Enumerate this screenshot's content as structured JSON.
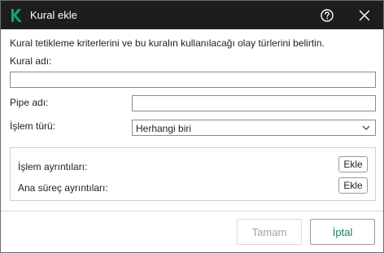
{
  "window": {
    "title": "Kural ekle",
    "icons": {
      "logo": "kaspersky-k-logo",
      "help": "question-circle-icon",
      "close": "close-x-icon"
    },
    "colors": {
      "titlebar": "#1d1d1d",
      "brand": "#00a88e",
      "cancel_text": "#1a7f60",
      "disabled_text": "#a3a3a3"
    }
  },
  "form": {
    "description": "Kural tetikleme kriterlerini ve bu kuralın kullanılacağı olay türlerini belirtin.",
    "rule_name": {
      "label": "Kural adı:",
      "value": ""
    },
    "pipe_name": {
      "label": "Pipe adı:",
      "value": ""
    },
    "operation_type": {
      "label": "İşlem türü:",
      "selected": "Herhangi biri"
    }
  },
  "details": {
    "operation_details_label": "İşlem ayrıntıları:",
    "operation_add_label": "Ekle",
    "parent_details_label": "Ana süreç ayrıntıları:",
    "parent_add_label": "Ekle"
  },
  "footer": {
    "ok_label": "Tamam",
    "ok_enabled": false,
    "cancel_label": "İptal"
  }
}
